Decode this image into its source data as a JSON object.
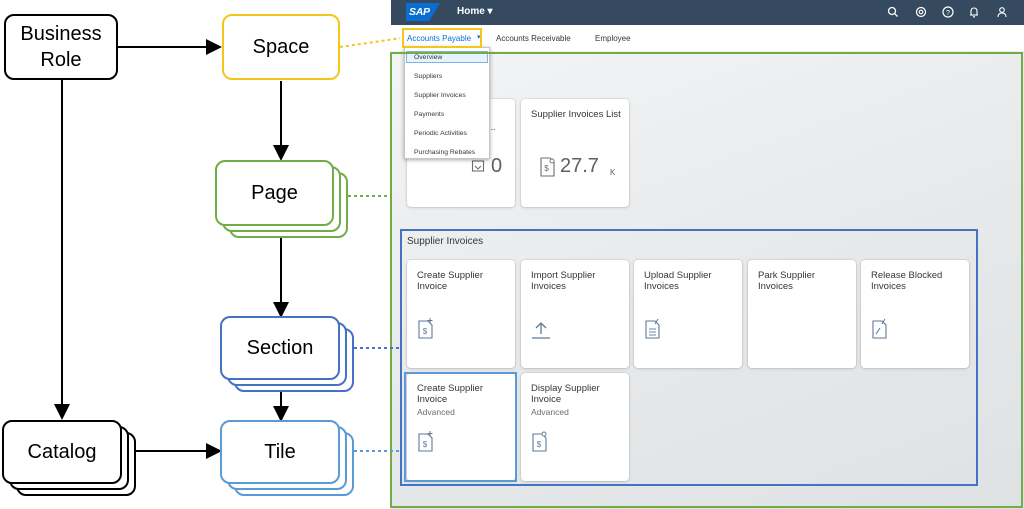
{
  "diagram": {
    "business_role": "Business\nRole",
    "space": "Space",
    "page": "Page",
    "section": "Section",
    "catalog": "Catalog",
    "tile": "Tile"
  },
  "colors": {
    "space": "#f5c518",
    "page": "#70ad47",
    "section": "#4472c4",
    "tile": "#5b9bd5",
    "shellbar": "#354a5f",
    "sap_blue": "#0a6ed1"
  },
  "shell": {
    "logo": "SAP",
    "home_label": "Home ▾",
    "icons": [
      "search-icon",
      "copilot-icon",
      "help-icon",
      "notifications-icon",
      "user-icon"
    ]
  },
  "tabs": [
    {
      "label": "Accounts Payable",
      "active": true
    },
    {
      "label": "Accounts Receivable",
      "active": false
    },
    {
      "label": "Employee",
      "active": false
    }
  ],
  "dropdown": {
    "items": [
      "Overview",
      "Suppliers",
      "Supplier Invoices",
      "Payments",
      "Periodic Activities",
      "Purchasing Rebates"
    ]
  },
  "top_tiles": [
    {
      "title": "...s...",
      "value": "0",
      "icon": "inbox-icon"
    },
    {
      "title": "Supplier Invoices List",
      "value": "27.7",
      "unit": "K",
      "icon": "invoice-icon"
    }
  ],
  "section": {
    "title": "Supplier Invoices",
    "tiles": [
      {
        "title": "Create Supplier Invoice",
        "subtitle": "",
        "icon": "create-invoice-icon"
      },
      {
        "title": "Import Supplier Invoices",
        "subtitle": "",
        "icon": "upload-icon"
      },
      {
        "title": "Upload Supplier Invoices",
        "subtitle": "",
        "icon": "upload-invoice-icon"
      },
      {
        "title": "Park Supplier Invoices",
        "subtitle": "",
        "icon": "none"
      },
      {
        "title": "Release Blocked Invoices",
        "subtitle": "",
        "icon": "release-invoice-icon"
      },
      {
        "title": "Create Supplier Invoice",
        "subtitle": "Advanced",
        "icon": "create-invoice-icon"
      },
      {
        "title": "Display Supplier Invoice",
        "subtitle": "Advanced",
        "icon": "display-invoice-icon"
      }
    ]
  }
}
